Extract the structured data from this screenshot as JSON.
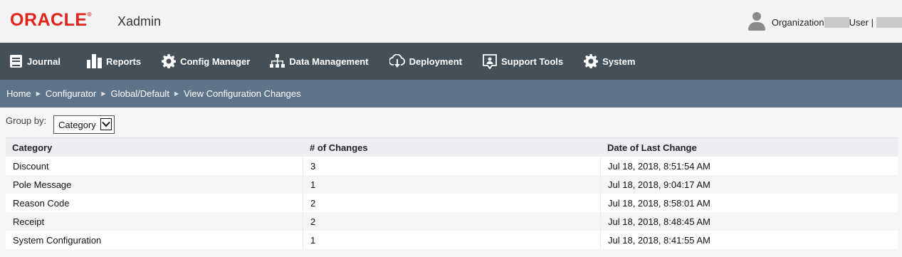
{
  "brand": {
    "logo": "ORACLE",
    "trademark": "®",
    "app_name": "Xadmin"
  },
  "user": {
    "org_label": "Organization",
    "user_label": "User |"
  },
  "nav": [
    {
      "label": "Journal",
      "icon": "journal-icon"
    },
    {
      "label": "Reports",
      "icon": "bar-chart-icon"
    },
    {
      "label": "Config Manager",
      "icon": "gear-icon"
    },
    {
      "label": "Data Management",
      "icon": "hierarchy-icon"
    },
    {
      "label": "Deployment",
      "icon": "cloud-download-icon"
    },
    {
      "label": "Support Tools",
      "icon": "support-icon"
    },
    {
      "label": "System",
      "icon": "gear-icon"
    }
  ],
  "breadcrumb": [
    "Home",
    "Configurator",
    "Global/Default",
    "View Configuration Changes"
  ],
  "groupby": {
    "label": "Group by:",
    "value": "Category"
  },
  "table": {
    "headers": [
      "Category",
      "# of Changes",
      "Date of Last Change"
    ],
    "rows": [
      [
        "Discount",
        "3",
        "Jul 18, 2018, 8:51:54 AM"
      ],
      [
        "Pole Message",
        "1",
        "Jul 18, 2018, 9:04:17 AM"
      ],
      [
        "Reason Code",
        "2",
        "Jul 18, 2018, 8:58:01 AM"
      ],
      [
        "Receipt",
        "2",
        "Jul 18, 2018, 8:48:45 AM"
      ],
      [
        "System Configuration",
        "1",
        "Jul 18, 2018, 8:41:55 AM"
      ]
    ]
  },
  "colors": {
    "brand_red": "#e2231a",
    "nav_bg": "#444f57",
    "breadcrumb_bg": "#5e7589"
  }
}
